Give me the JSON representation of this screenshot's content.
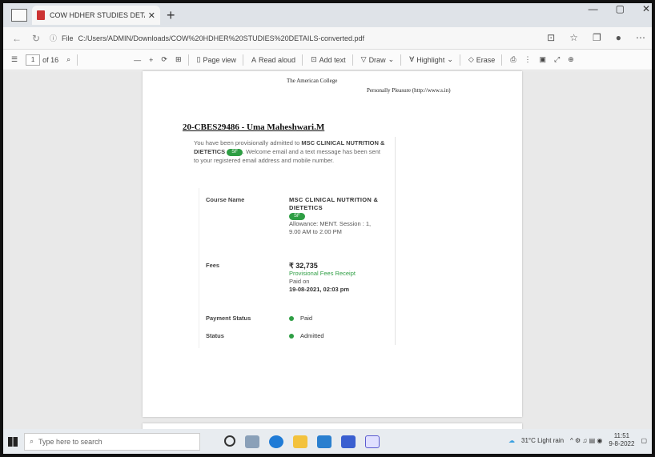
{
  "browser": {
    "tab_title": "COW HDHER STUDIES DETAILS",
    "url": "C:/Users/ADMIN/Downloads/COW%20HDHER%20STUDIES%20DETAILS-converted.pdf",
    "url_prefix": "File"
  },
  "pdf_toolbar": {
    "page_current": "1",
    "page_total": "of 16",
    "page_view": "Page view",
    "read_aloud": "Read aloud",
    "add_text": "Add text",
    "draw": "Draw",
    "highlight": "Highlight",
    "erase": "Erase"
  },
  "document": {
    "college": "The American College",
    "signature": "Personally Pleasure (http://www.s.in)",
    "heading": "20-CBES29486 - Uma Maheshwari.M",
    "message_prefix": "You have been provisionally admitted to ",
    "message_course": "MSC CLINICAL NUTRITION & DIETETICS",
    "message_badge": "SF",
    "message_suffix": ". Welcome email and a text message has been sent to your registered email address and mobile number.",
    "rows": [
      {
        "key": "Course Name",
        "course": "MSC CLINICAL NUTRITION & DIETETICS",
        "badge": "SF",
        "detail": "Allowance: MENT. Session : 1, 9.00 AM to 2.00 PM"
      },
      {
        "key": "Fees",
        "fee": "₹ 32,735",
        "receipt": "Provisional Fees Receipt",
        "paid_label": "Paid on",
        "paid_on": "19-08-2021, 02:03 pm"
      },
      {
        "key": "Payment Status",
        "status": "Paid"
      },
      {
        "key": "Status",
        "status": "Admitted"
      }
    ]
  },
  "taskbar": {
    "search_placeholder": "Type here to search",
    "weather": "31°C Light rain",
    "time": "11:51",
    "date": "9-8-2022"
  }
}
